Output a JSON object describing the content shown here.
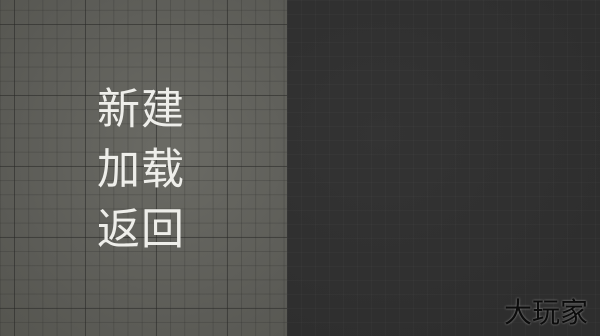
{
  "menu": {
    "items": [
      {
        "label": "新建"
      },
      {
        "label": "加载"
      },
      {
        "label": "返回"
      }
    ]
  },
  "watermark": {
    "text": "大玩家"
  },
  "colors": {
    "left_panel": "#5f5f5a",
    "right_panel": "#303030",
    "menu_text": "#eeeeea"
  }
}
